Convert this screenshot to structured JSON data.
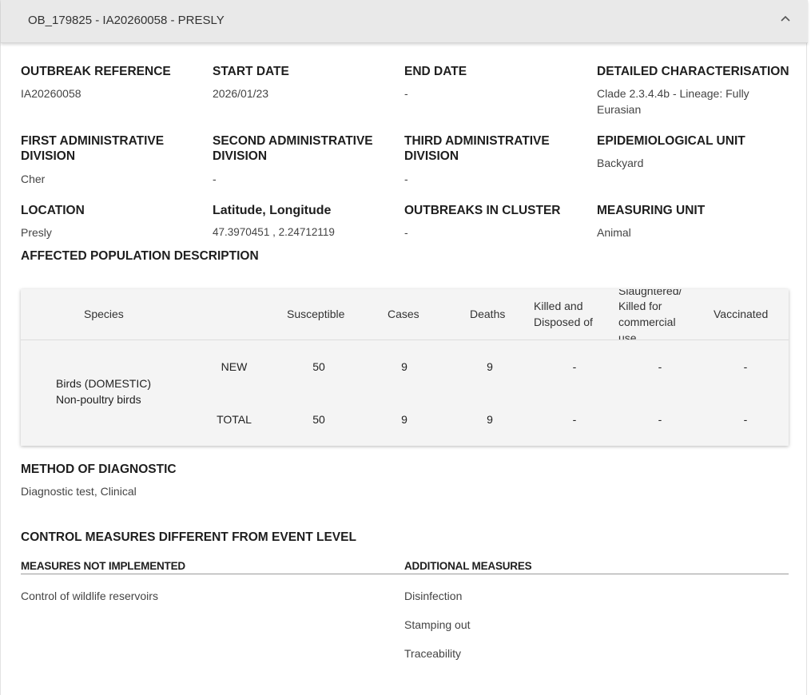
{
  "header": {
    "title": "OB_179825 - IA20260058 - PRESLY"
  },
  "fields": {
    "outbreak_reference": {
      "label": "OUTBREAK REFERENCE",
      "value": "IA20260058"
    },
    "start_date": {
      "label": "START DATE",
      "value": "2026/01/23"
    },
    "end_date": {
      "label": "END DATE",
      "value": "-"
    },
    "detailed_characterisation": {
      "label": "DETAILED CHARACTERISATION",
      "value_line1": "Clade 2.3.4.4b - Lineage: Fully",
      "value_line2": "Eurasian"
    },
    "first_admin": {
      "label_line1": "FIRST ADMINISTRATIVE",
      "label_line2": "DIVISION",
      "value": "Cher"
    },
    "second_admin": {
      "label_line1": "SECOND ADMINISTRATIVE",
      "label_line2": "DIVISION",
      "value": "-"
    },
    "third_admin": {
      "label_line1": "THIRD ADMINISTRATIVE",
      "label_line2": "DIVISION",
      "value": "-"
    },
    "epidemiological_unit": {
      "label": "EPIDEMIOLOGICAL UNIT",
      "value": "Backyard"
    },
    "location": {
      "label": "LOCATION",
      "value": "Presly"
    },
    "lat_long": {
      "label": "Latitude, Longitude",
      "value": "47.3970451 , 2.24712119"
    },
    "outbreaks_in_cluster": {
      "label": "OUTBREAKS IN CLUSTER",
      "value": "-"
    },
    "measuring_unit": {
      "label": "MEASURING UNIT",
      "value": "Animal"
    }
  },
  "affected": {
    "title": "AFFECTED POPULATION DESCRIPTION",
    "columns": {
      "species": "Species",
      "susceptible": "Susceptible",
      "cases": "Cases",
      "deaths": "Deaths",
      "killed_1": "Killed and",
      "killed_2": "Disposed of",
      "slaughtered_1": "Slaughtered/",
      "slaughtered_2": "Killed for",
      "slaughtered_3": "commercial",
      "slaughtered_4": "use",
      "vaccinated": "Vaccinated"
    },
    "species_line1": "Birds (DOMESTIC)",
    "species_line2": "Non-poultry birds",
    "rows": [
      {
        "type": "NEW",
        "susceptible": "50",
        "cases": "9",
        "deaths": "9",
        "killed": "-",
        "slaughtered": "-",
        "vaccinated": "-"
      },
      {
        "type": "TOTAL",
        "susceptible": "50",
        "cases": "9",
        "deaths": "9",
        "killed": "-",
        "slaughtered": "-",
        "vaccinated": "-"
      }
    ]
  },
  "diagnostic": {
    "label": "METHOD OF DIAGNOSTIC",
    "value": "Diagnostic test, Clinical"
  },
  "control": {
    "title": "CONTROL MEASURES DIFFERENT FROM EVENT LEVEL",
    "not_implemented_label": "MEASURES NOT IMPLEMENTED",
    "not_implemented": [
      "Control of wildlife reservoirs"
    ],
    "additional_label": "ADDITIONAL MEASURES",
    "additional": [
      "Disinfection",
      "Stamping out",
      "Traceability"
    ]
  },
  "icons": {
    "collapse": "chevron-up-icon"
  }
}
